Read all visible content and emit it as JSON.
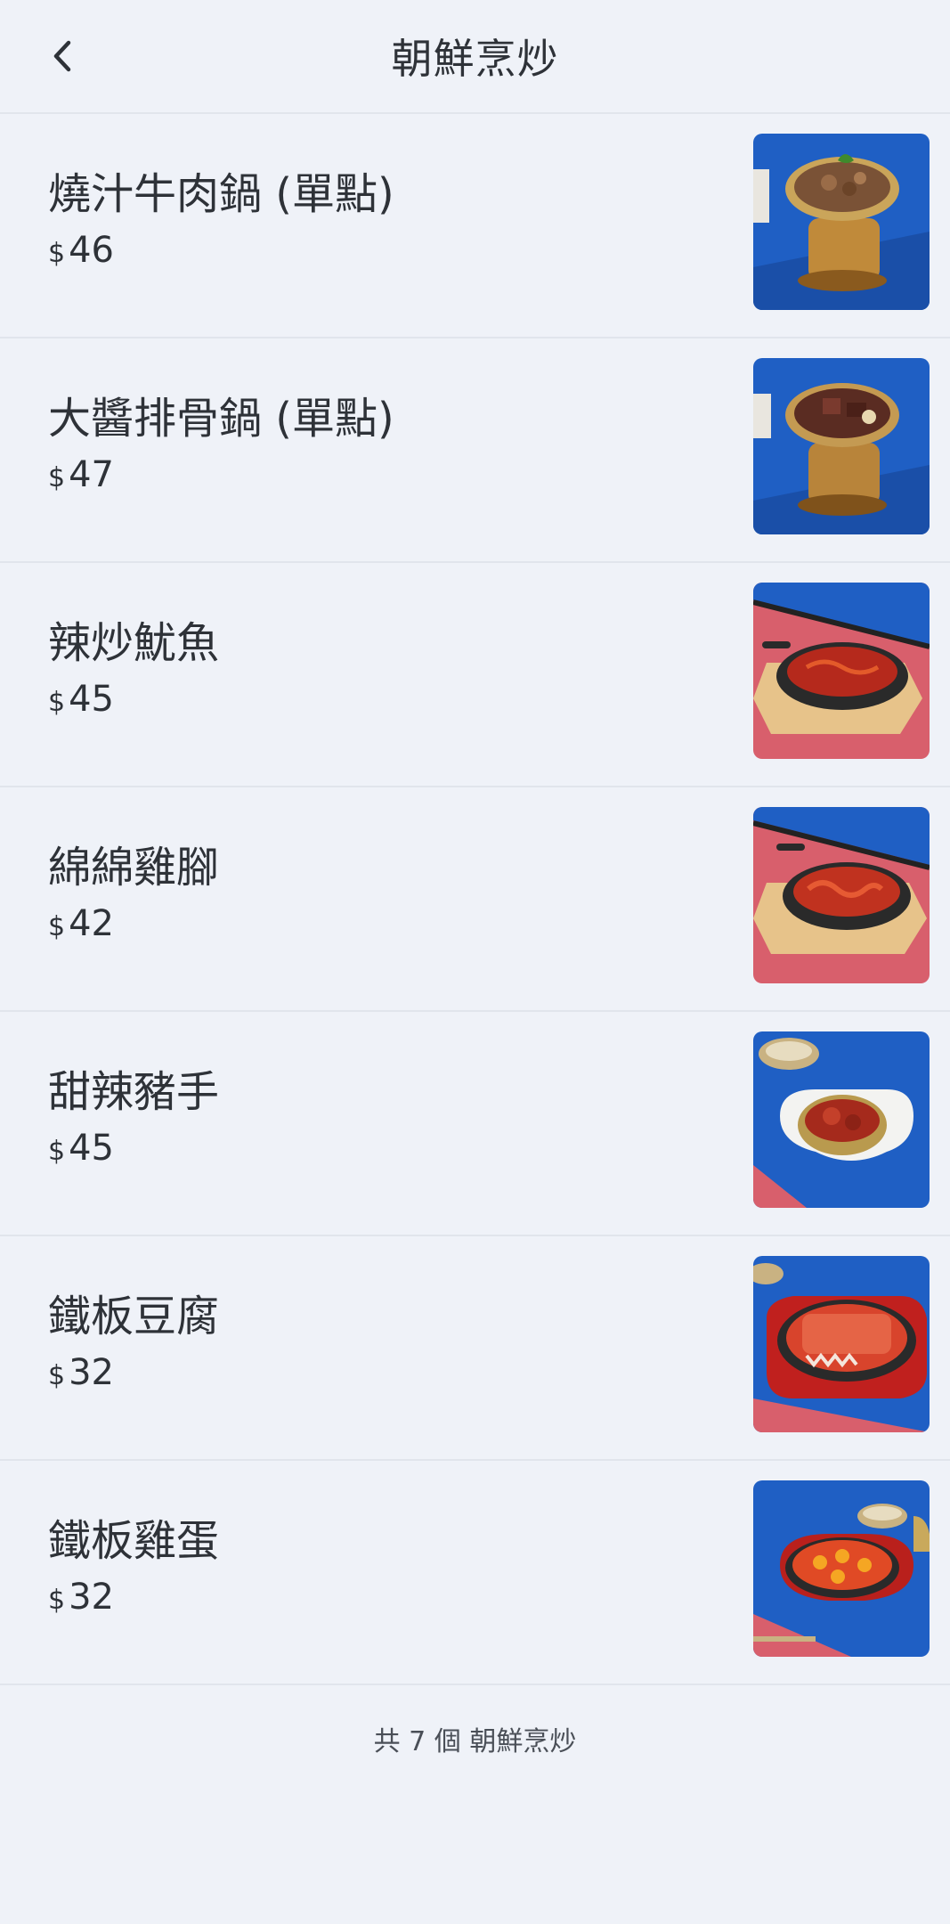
{
  "header": {
    "title": "朝鮮烹炒",
    "back_icon": "chevron-left-icon"
  },
  "currency_symbol": "$",
  "items": [
    {
      "name": "燒汁牛肉鍋 (單點)",
      "price": "46"
    },
    {
      "name": "大醬排骨鍋 (單點)",
      "price": "47"
    },
    {
      "name": "辣炒魷魚",
      "price": "45"
    },
    {
      "name": "綿綿雞腳",
      "price": "42"
    },
    {
      "name": "甜辣豬手",
      "price": "45"
    },
    {
      "name": "鐵板豆腐",
      "price": "32"
    },
    {
      "name": "鐵板雞蛋",
      "price": "32"
    }
  ],
  "footer": {
    "count_text": "共 7 個 朝鮮烹炒"
  },
  "colors": {
    "background": "#eff2f8",
    "divider": "#e1e5ec",
    "photo_blue": "#1f5fc4",
    "photo_pink": "#d85f6c"
  }
}
